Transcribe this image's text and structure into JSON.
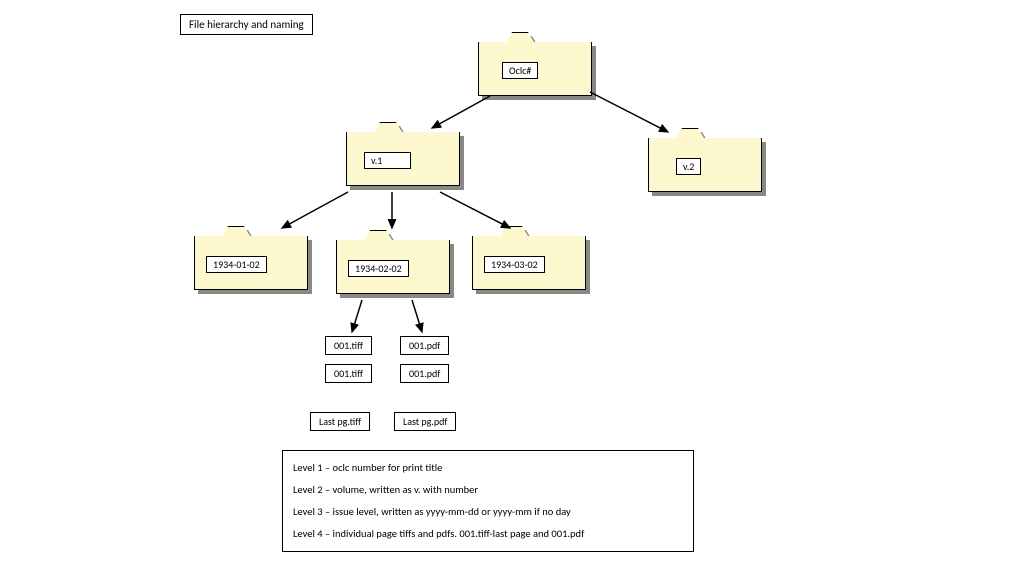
{
  "title": "File hierarchy and naming",
  "folders": {
    "root": "Oclc#",
    "v1": "v.1",
    "v2": "v.2",
    "issue1": "1934-01-02",
    "issue2": "1934-02-02",
    "issue3": "1934-03-02"
  },
  "files": {
    "tiff_a": "001.tiff",
    "pdf_a": "001.pdf",
    "tiff_b": "001.tiff",
    "pdf_b": "001.pdf",
    "last_tiff": "Last pg.tiff",
    "last_pdf": "Last pg.pdf"
  },
  "legend": {
    "l1": "Level 1 – oclc number for print title",
    "l2": "Level 2 – volume, written as v. with number",
    "l3": "Level 3 – issue level, written as yyyy-mm-dd or yyyy-mm if no day",
    "l4": "Level 4 – individual page tiffs and pdfs. 001.tiff-last page and 001.pdf"
  }
}
